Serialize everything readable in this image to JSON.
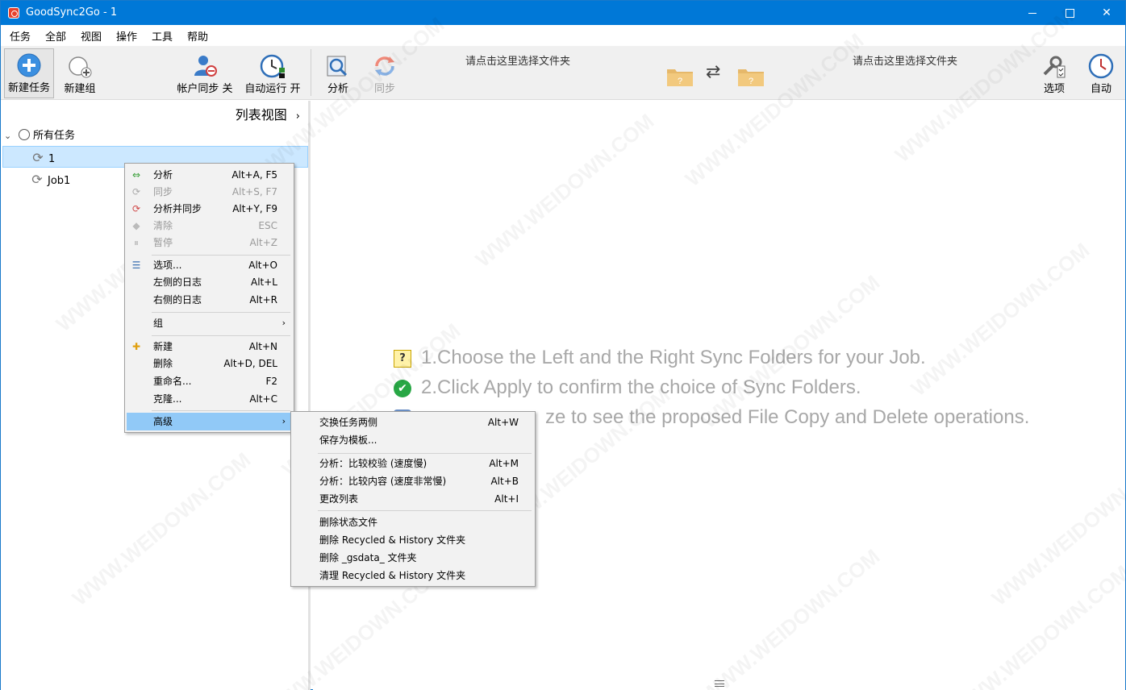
{
  "window": {
    "title": "GoodSync2Go - 1"
  },
  "menubar": [
    "任务",
    "全部",
    "视图",
    "操作",
    "工具",
    "帮助"
  ],
  "toolbar": {
    "new_task": "新建任务",
    "new_group": "新建组",
    "account_sync": "帐户同步 关",
    "auto_run": "自动运行 开",
    "analyze": "分析",
    "sync": "同步",
    "left_folder_prompt": "请点击这里选择文件夹",
    "right_folder_prompt": "请点击这里选择文件夹",
    "options": "选项",
    "auto": "自动"
  },
  "left_panel": {
    "view_header": "列表视图",
    "root_label": "所有任务",
    "jobs": [
      "1",
      "Job1"
    ]
  },
  "hints": [
    "1.Choose the Left and the Right Sync Folders for your Job.",
    "2.Click Apply to confirm the choice of Sync Folders.",
    "ze to see the proposed File Copy and Delete operations."
  ],
  "watermark": "WWW.WEIDOWN.COM",
  "context_menu": {
    "items": [
      {
        "label": "分析",
        "shortcut": "Alt+A, F5",
        "icon": "analyze-arrows-icon",
        "disabled": false
      },
      {
        "label": "同步",
        "shortcut": "Alt+S, F7",
        "icon": "sync-icon",
        "disabled": true
      },
      {
        "label": "分析并同步",
        "shortcut": "Alt+Y, F9",
        "icon": "analyze-sync-icon",
        "disabled": false
      },
      {
        "label": "清除",
        "shortcut": "ESC",
        "icon": "eraser-icon",
        "disabled": true
      },
      {
        "label": "暂停",
        "shortcut": "Alt+Z",
        "icon": "pause-icon",
        "disabled": true
      },
      {
        "label": "选项...",
        "shortcut": "Alt+O",
        "icon": "options-icon",
        "disabled": false
      },
      {
        "label": "左侧的日志",
        "shortcut": "Alt+L",
        "icon": "",
        "disabled": false
      },
      {
        "label": "右侧的日志",
        "shortcut": "Alt+R",
        "icon": "",
        "disabled": false
      },
      {
        "label": "组",
        "shortcut": "",
        "icon": "",
        "disabled": false
      },
      {
        "label": "新建",
        "shortcut": "Alt+N",
        "icon": "plus-icon",
        "disabled": false
      },
      {
        "label": "删除",
        "shortcut": "Alt+D, DEL",
        "icon": "",
        "disabled": false
      },
      {
        "label": "重命名...",
        "shortcut": "F2",
        "icon": "",
        "disabled": false
      },
      {
        "label": "克隆...",
        "shortcut": "Alt+C",
        "icon": "",
        "disabled": false
      },
      {
        "label": "高级",
        "shortcut": "",
        "icon": "",
        "disabled": false
      }
    ]
  },
  "advanced_submenu": {
    "items": [
      {
        "label": "交换任务两侧",
        "shortcut": "Alt+W"
      },
      {
        "label": "保存为模板...",
        "shortcut": ""
      },
      {
        "label": "分析：比较校验 (速度慢)",
        "shortcut": "Alt+M"
      },
      {
        "label": "分析：比较内容 (速度非常慢)",
        "shortcut": "Alt+B"
      },
      {
        "label": "更改列表",
        "shortcut": "Alt+I"
      },
      {
        "label": "删除状态文件",
        "shortcut": ""
      },
      {
        "label": "删除 Recycled & History 文件夹",
        "shortcut": ""
      },
      {
        "label": "删除 _gsdata_ 文件夹",
        "shortcut": ""
      },
      {
        "label": "清理 Recycled & History 文件夹",
        "shortcut": ""
      }
    ]
  },
  "colors": {
    "titlebar": "#0078d7",
    "selection": "#cce8ff",
    "menu_highlight": "#91c9f7",
    "hint_text": "#a8a8a8"
  }
}
